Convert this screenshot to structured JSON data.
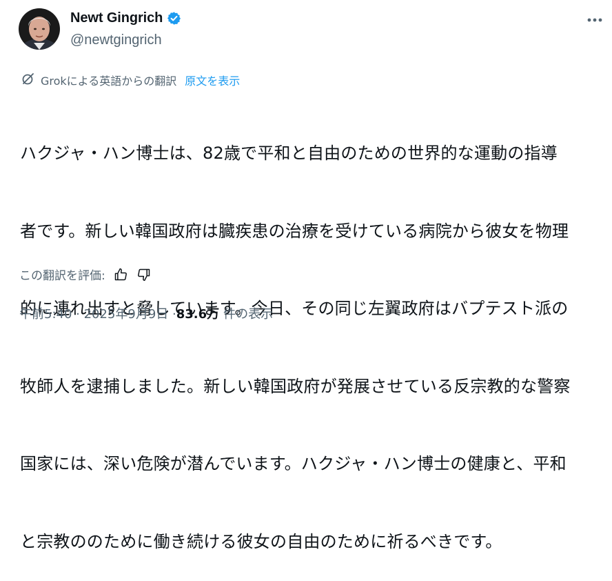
{
  "author": {
    "name": "Newt Gingrich",
    "handle": "@newtgingrich",
    "avatar_icon": "profile-photo",
    "verified_icon": "verified-badge-icon",
    "verified_color": "#1d9bf0"
  },
  "menu": {
    "more_icon": "more-horizontal-icon"
  },
  "translation": {
    "icon": "grok-icon",
    "label": "Grokによる英語からの翻訳",
    "show_original": "原文を表示"
  },
  "tweet": {
    "text_lines": [
      "ハクジャ・ハン博士は、82歳で平和と自由のための世界的な運動の指導",
      "者です。新しい韓国政府は臓疾患の治療を受けている病院から彼女を物理",
      "的に連れ出すと脅しています。今日、その同じ左翼政府はバプテスト派の",
      "牧師人を逮捕しました。新しい韓国政府が発展させている反宗教的な警察",
      "国家には、深い危険が潜んでいます。ハクジャ・ハン博士の健康と、平和",
      "と宗教ののために働き続ける彼女の自由のために祈るべきです。"
    ]
  },
  "rating": {
    "label": "この翻訳を評価:",
    "thumbs_up_icon": "thumbs-up-icon",
    "thumbs_down_icon": "thumbs-down-icon"
  },
  "meta": {
    "time_date": "午前5:40 · 2025年9月9日 · ",
    "views_count": "83.6万",
    "views_label": "件の表示"
  }
}
